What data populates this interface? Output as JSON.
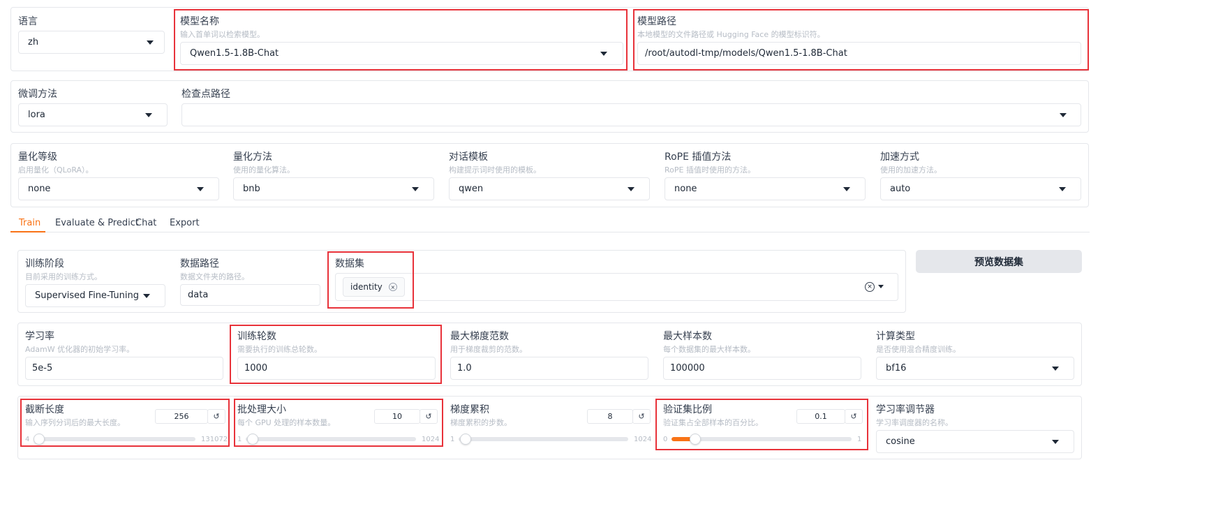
{
  "top": {
    "language": {
      "label": "语言",
      "value": "zh"
    },
    "model_name": {
      "label": "模型名称",
      "info": "输入首单词以检索模型。",
      "value": "Qwen1.5-1.8B-Chat"
    },
    "model_path": {
      "label": "模型路径",
      "info": "本地模型的文件路径或 Hugging Face 的模型标识符。",
      "value": "/root/autodl-tmp/models/Qwen1.5-1.8B-Chat"
    }
  },
  "finetune": {
    "method": {
      "label": "微调方法",
      "value": "lora"
    },
    "checkpoint": {
      "label": "检查点路径",
      "value": ""
    }
  },
  "advanced": {
    "quant_bit": {
      "label": "量化等级",
      "info": "启用量化（QLoRA）。",
      "value": "none"
    },
    "quant_method": {
      "label": "量化方法",
      "info": "使用的量化算法。",
      "value": "bnb"
    },
    "template": {
      "label": "对话模板",
      "info": "构建提示词时使用的模板。",
      "value": "qwen"
    },
    "rope": {
      "label": "RoPE 插值方法",
      "info": "RoPE 插值时使用的方法。",
      "value": "none"
    },
    "booster": {
      "label": "加速方式",
      "info": "使用的加速方法。",
      "value": "auto"
    }
  },
  "tabs": [
    "Train",
    "Evaluate & Predict",
    "Chat",
    "Export"
  ],
  "train": {
    "stage": {
      "label": "训练阶段",
      "info": "目前采用的训练方式。",
      "value": "Supervised Fine-Tuning"
    },
    "dataset_dir": {
      "label": "数据路径",
      "info": "数据文件夹的路径。",
      "value": "data"
    },
    "dataset": {
      "label": "数据集",
      "tags": [
        "identity"
      ]
    },
    "preview_button": "预览数据集",
    "learning_rate": {
      "label": "学习率",
      "info": "AdamW 优化器的初始学习率。",
      "value": "5e-5"
    },
    "epochs": {
      "label": "训练轮数",
      "info": "需要执行的训练总轮数。",
      "value": "1000"
    },
    "max_grad_norm": {
      "label": "最大梯度范数",
      "info": "用于梯度裁剪的范数。",
      "value": "1.0"
    },
    "max_samples": {
      "label": "最大样本数",
      "info": "每个数据集的最大样本数。",
      "value": "100000"
    },
    "compute_type": {
      "label": "计算类型",
      "info": "是否使用混合精度训练。",
      "value": "bf16"
    },
    "cutoff_len": {
      "label": "截断长度",
      "info": "输入序列分词后的最大长度。",
      "value": "256",
      "min": "4",
      "max": "131072",
      "fraction": 0.0019
    },
    "batch_size": {
      "label": "批处理大小",
      "info": "每个 GPU 处理的样本数量。",
      "value": "10",
      "min": "1",
      "max": "1024",
      "fraction": 0.0088
    },
    "grad_accum": {
      "label": "梯度累积",
      "info": "梯度累积的步数。",
      "value": "8",
      "min": "1",
      "max": "1024",
      "fraction": 0.0068
    },
    "val_size": {
      "label": "验证集比例",
      "info": "验证集占全部样本的百分比。",
      "value": "0.1",
      "min": "0",
      "max": "1",
      "fraction": 0.1
    },
    "lr_scheduler": {
      "label": "学习率调节器",
      "info": "学习率调度器的名称。",
      "value": "cosine"
    },
    "reset_glyph": "↺",
    "remove_glyph": "×"
  }
}
